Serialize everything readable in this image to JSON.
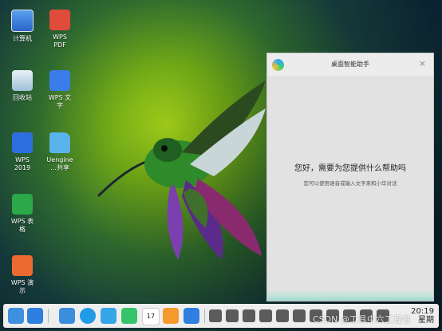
{
  "desktop_icons": [
    {
      "label": "计算机",
      "icon": "computer-icon",
      "color": "#3b82d6"
    },
    {
      "label": "WPS\nPDF",
      "icon": "wps-pdf-icon",
      "color": "#e14b3b"
    },
    {
      "label": "回收站",
      "icon": "trash-icon",
      "color": "#7fa6c6"
    },
    {
      "label": "WPS 文\n字",
      "icon": "wps-writer-icon",
      "color": "#3b7de8"
    },
    {
      "label": "WPS\n2019",
      "icon": "wps-2019-icon",
      "color": "#2d6fe0"
    },
    {
      "label": "Uengine\n…共享",
      "icon": "folder-icon",
      "color": "#5ab3ea"
    },
    {
      "label": "WPS 表\n格",
      "icon": "wps-sheet-icon",
      "color": "#2aa84a"
    },
    {
      "label": "WPS 演\n示",
      "icon": "wps-slides-icon",
      "color": "#ec6a2f"
    }
  ],
  "assistant": {
    "title": "桌面智能助手",
    "greeting": "您好，需要为您提供什么帮助吗",
    "hint": "您可以使用语音或输入文字来和小华对话",
    "close_glyph": "×"
  },
  "taskbar": {
    "time": "20:19",
    "date": "星期",
    "apps": [
      {
        "icon": "multitask-icon",
        "color": "#3d8fe0"
      },
      {
        "icon": "home-icon",
        "color": "#2f7fe0"
      },
      {
        "icon": "file-manager-icon",
        "color": "#3b8ddd"
      },
      {
        "icon": "browser-icon",
        "color": "#1f9be8"
      },
      {
        "icon": "photos-icon",
        "color": "#35a6e8"
      },
      {
        "icon": "music-icon",
        "color": "#36c46a"
      },
      {
        "icon": "calendar-icon",
        "color": "#ffffff"
      },
      {
        "icon": "store-icon",
        "color": "#f39a2b"
      },
      {
        "icon": "settings-icon",
        "color": "#2f7fe0"
      }
    ],
    "tray": [
      "tray-1-icon",
      "tray-2-icon",
      "usb-icon",
      "volume-icon",
      "pen-icon",
      "battery-icon",
      "notification-icon",
      "mail-icon",
      "dropbox-icon",
      "chat-icon",
      "folder-tray-icon"
    ],
    "calendar_day": "17"
  },
  "watermark": "CSDN @工具中六工程者"
}
